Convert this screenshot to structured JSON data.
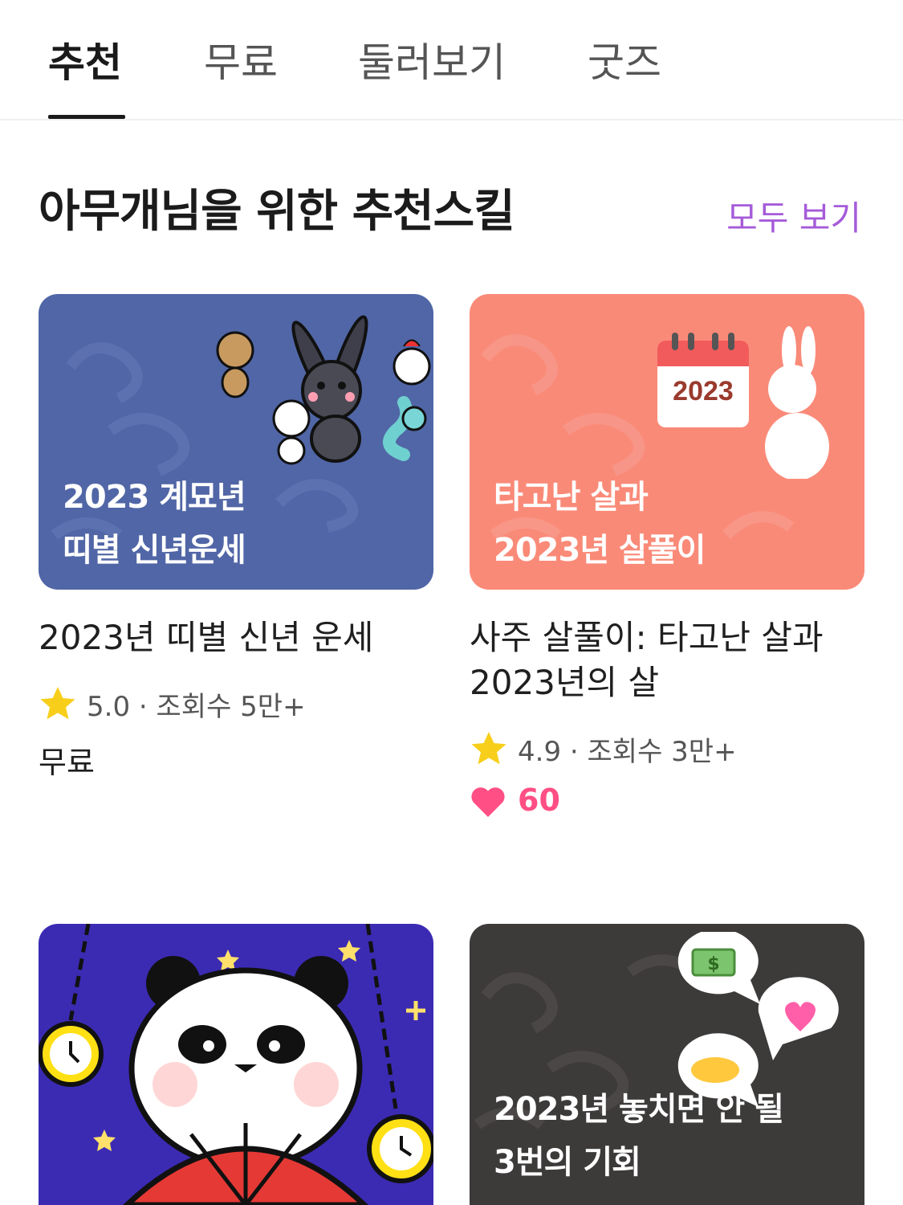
{
  "tabs": [
    {
      "label": "추천",
      "active": true
    },
    {
      "label": "무료"
    },
    {
      "label": "둘러보기"
    },
    {
      "label": "굿즈"
    }
  ],
  "section": {
    "title": "아무개님을 위한 추천스킬",
    "see_all": "모두 보기"
  },
  "cards": [
    {
      "image_lines": [
        "2023 계묘년",
        "띠별 신년운세"
      ],
      "image_bg": "#5166a6",
      "title": "2023년 띠별 신년 운세",
      "rating": "5.0",
      "views": "· 조회수 5만+",
      "price": "무료"
    },
    {
      "image_lines": [
        "타고난 살과",
        "2023년 살풀이"
      ],
      "image_bg": "#fa8a78",
      "calendar_year": "2023",
      "title_lines": [
        "사주 살풀이: 타고난 살과",
        "2023년의 살"
      ],
      "rating": "4.9",
      "views": "· 조회수 3만+",
      "likes": "60"
    },
    {
      "image_bg": "#3b2bb3"
    },
    {
      "image_lines": [
        "2023년 놓치면 안 될",
        "3번의 기회"
      ],
      "image_bg": "#3d3a3a"
    }
  ],
  "colors": {
    "accent": "#a55bd9",
    "star": "#f7cf1b",
    "heart": "#ff4f84"
  },
  "icons": [
    "star-icon",
    "heart-icon",
    "money-emoji-icon",
    "heart-sparkle-emoji-icon",
    "handshake-emoji-icon"
  ]
}
